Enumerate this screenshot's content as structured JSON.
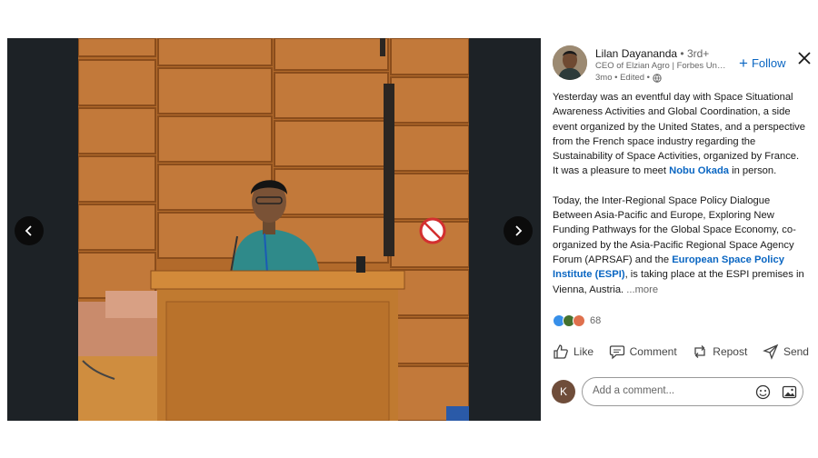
{
  "viewer": {
    "prev_icon": "chevron-left-icon",
    "next_icon": "chevron-right-icon"
  },
  "author": {
    "name": "Lilan Dayananda",
    "degree": "• 3rd+",
    "headline": "CEO of Elzian Agro | Forbes Unde...",
    "time": "3mo • Edited •",
    "visibility_icon": "globe-icon"
  },
  "follow_label": "Follow",
  "post": {
    "p1_before": "Yesterday was an eventful day with Space Situational Awareness Activities and Global Coordination, a side event organized by the United States, and a perspective from the French space industry regarding the Sustainability of Space Activities, organized by France. It was a pleasure to meet ",
    "p1_mention": "Nobu Okada",
    "p1_after": " in person.",
    "p2_before": "Today, the Inter-Regional Space Policy Dialogue Between Asia-Pacific and Europe, Exploring New Funding Pathways for the Global Space Economy, co-organized by the Asia-Pacific Regional Space Agency Forum (APRSAF) and the ",
    "p2_mention": "European Space Policy Institute (ESPI)",
    "p2_after": ", is taking place at the ESPI premises in Vienna, Austria.  ",
    "more": "...more"
  },
  "reactions": {
    "count": "68",
    "colors": [
      "#378fe9",
      "#44712e",
      "#df704d"
    ]
  },
  "actions": {
    "like": "Like",
    "comment": "Comment",
    "repost": "Repost",
    "send": "Send"
  },
  "comment": {
    "avatar_letter": "K",
    "placeholder": "Add a comment..."
  }
}
